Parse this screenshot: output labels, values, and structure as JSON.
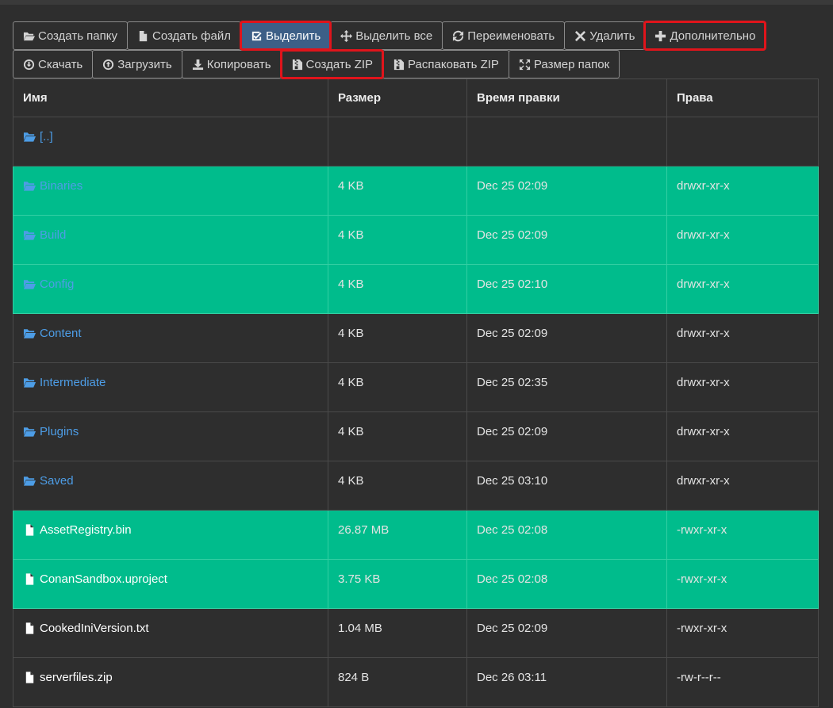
{
  "toolbar": {
    "row1": [
      {
        "label": "Создать папку",
        "icon": "folder-open-icon"
      },
      {
        "label": "Создать файл",
        "icon": "file-icon"
      },
      {
        "label": "Выделить",
        "icon": "check-square-icon",
        "active": true,
        "highlighted": true
      },
      {
        "label": "Выделить все",
        "icon": "move-arrows-icon"
      },
      {
        "label": "Переименовать",
        "icon": "refresh-icon"
      },
      {
        "label": "Удалить",
        "icon": "close-icon"
      },
      {
        "label": "Дополнительно",
        "icon": "plus-icon",
        "highlighted": true
      }
    ],
    "row2": [
      {
        "label": "Скачать",
        "icon": "download-circle-icon"
      },
      {
        "label": "Загрузить",
        "icon": "upload-circle-icon"
      },
      {
        "label": "Копировать",
        "icon": "download-icon"
      },
      {
        "label": "Создать ZIP",
        "icon": "file-zip-icon",
        "highlighted": true
      },
      {
        "label": "Распаковать ZIP",
        "icon": "file-zip-icon"
      },
      {
        "label": "Размер папок",
        "icon": "expand-icon"
      }
    ]
  },
  "table": {
    "columns": [
      "Имя",
      "Размер",
      "Время правки",
      "Права"
    ],
    "rows": [
      {
        "name": "[..]",
        "type": "folder",
        "size": "",
        "modified": "",
        "perms": "",
        "selected": false
      },
      {
        "name": "Binaries",
        "type": "folder",
        "size": "4 KB",
        "modified": "Dec 25 02:09",
        "perms": "drwxr-xr-x",
        "selected": true
      },
      {
        "name": "Build",
        "type": "folder",
        "size": "4 KB",
        "modified": "Dec 25 02:09",
        "perms": "drwxr-xr-x",
        "selected": true
      },
      {
        "name": "Config",
        "type": "folder",
        "size": "4 KB",
        "modified": "Dec 25 02:10",
        "perms": "drwxr-xr-x",
        "selected": true
      },
      {
        "name": "Content",
        "type": "folder",
        "size": "4 KB",
        "modified": "Dec 25 02:09",
        "perms": "drwxr-xr-x",
        "selected": false
      },
      {
        "name": "Intermediate",
        "type": "folder",
        "size": "4 KB",
        "modified": "Dec 25 02:35",
        "perms": "drwxr-xr-x",
        "selected": false
      },
      {
        "name": "Plugins",
        "type": "folder",
        "size": "4 KB",
        "modified": "Dec 25 02:09",
        "perms": "drwxr-xr-x",
        "selected": false
      },
      {
        "name": "Saved",
        "type": "folder",
        "size": "4 KB",
        "modified": "Dec 25 03:10",
        "perms": "drwxr-xr-x",
        "selected": false
      },
      {
        "name": "AssetRegistry.bin",
        "type": "file",
        "size": "26.87 MB",
        "modified": "Dec 25 02:08",
        "perms": "-rwxr-xr-x",
        "selected": true
      },
      {
        "name": "ConanSandbox.uproject",
        "type": "file",
        "size": "3.75 KB",
        "modified": "Dec 25 02:08",
        "perms": "-rwxr-xr-x",
        "selected": true
      },
      {
        "name": "CookedIniVersion.txt",
        "type": "file",
        "size": "1.04 MB",
        "modified": "Dec 25 02:09",
        "perms": "-rwxr-xr-x",
        "selected": false
      },
      {
        "name": "serverfiles.zip",
        "type": "file",
        "size": "824 B",
        "modified": "Dec 26 03:11",
        "perms": "-rw-r--r--",
        "selected": false
      }
    ]
  },
  "colors": {
    "background": "#2e2e2e",
    "selected_row": "#00bc8c",
    "active_button": "#3d5f87",
    "highlight_outline": "#e0141b",
    "folder_link": "#4d9de6"
  }
}
